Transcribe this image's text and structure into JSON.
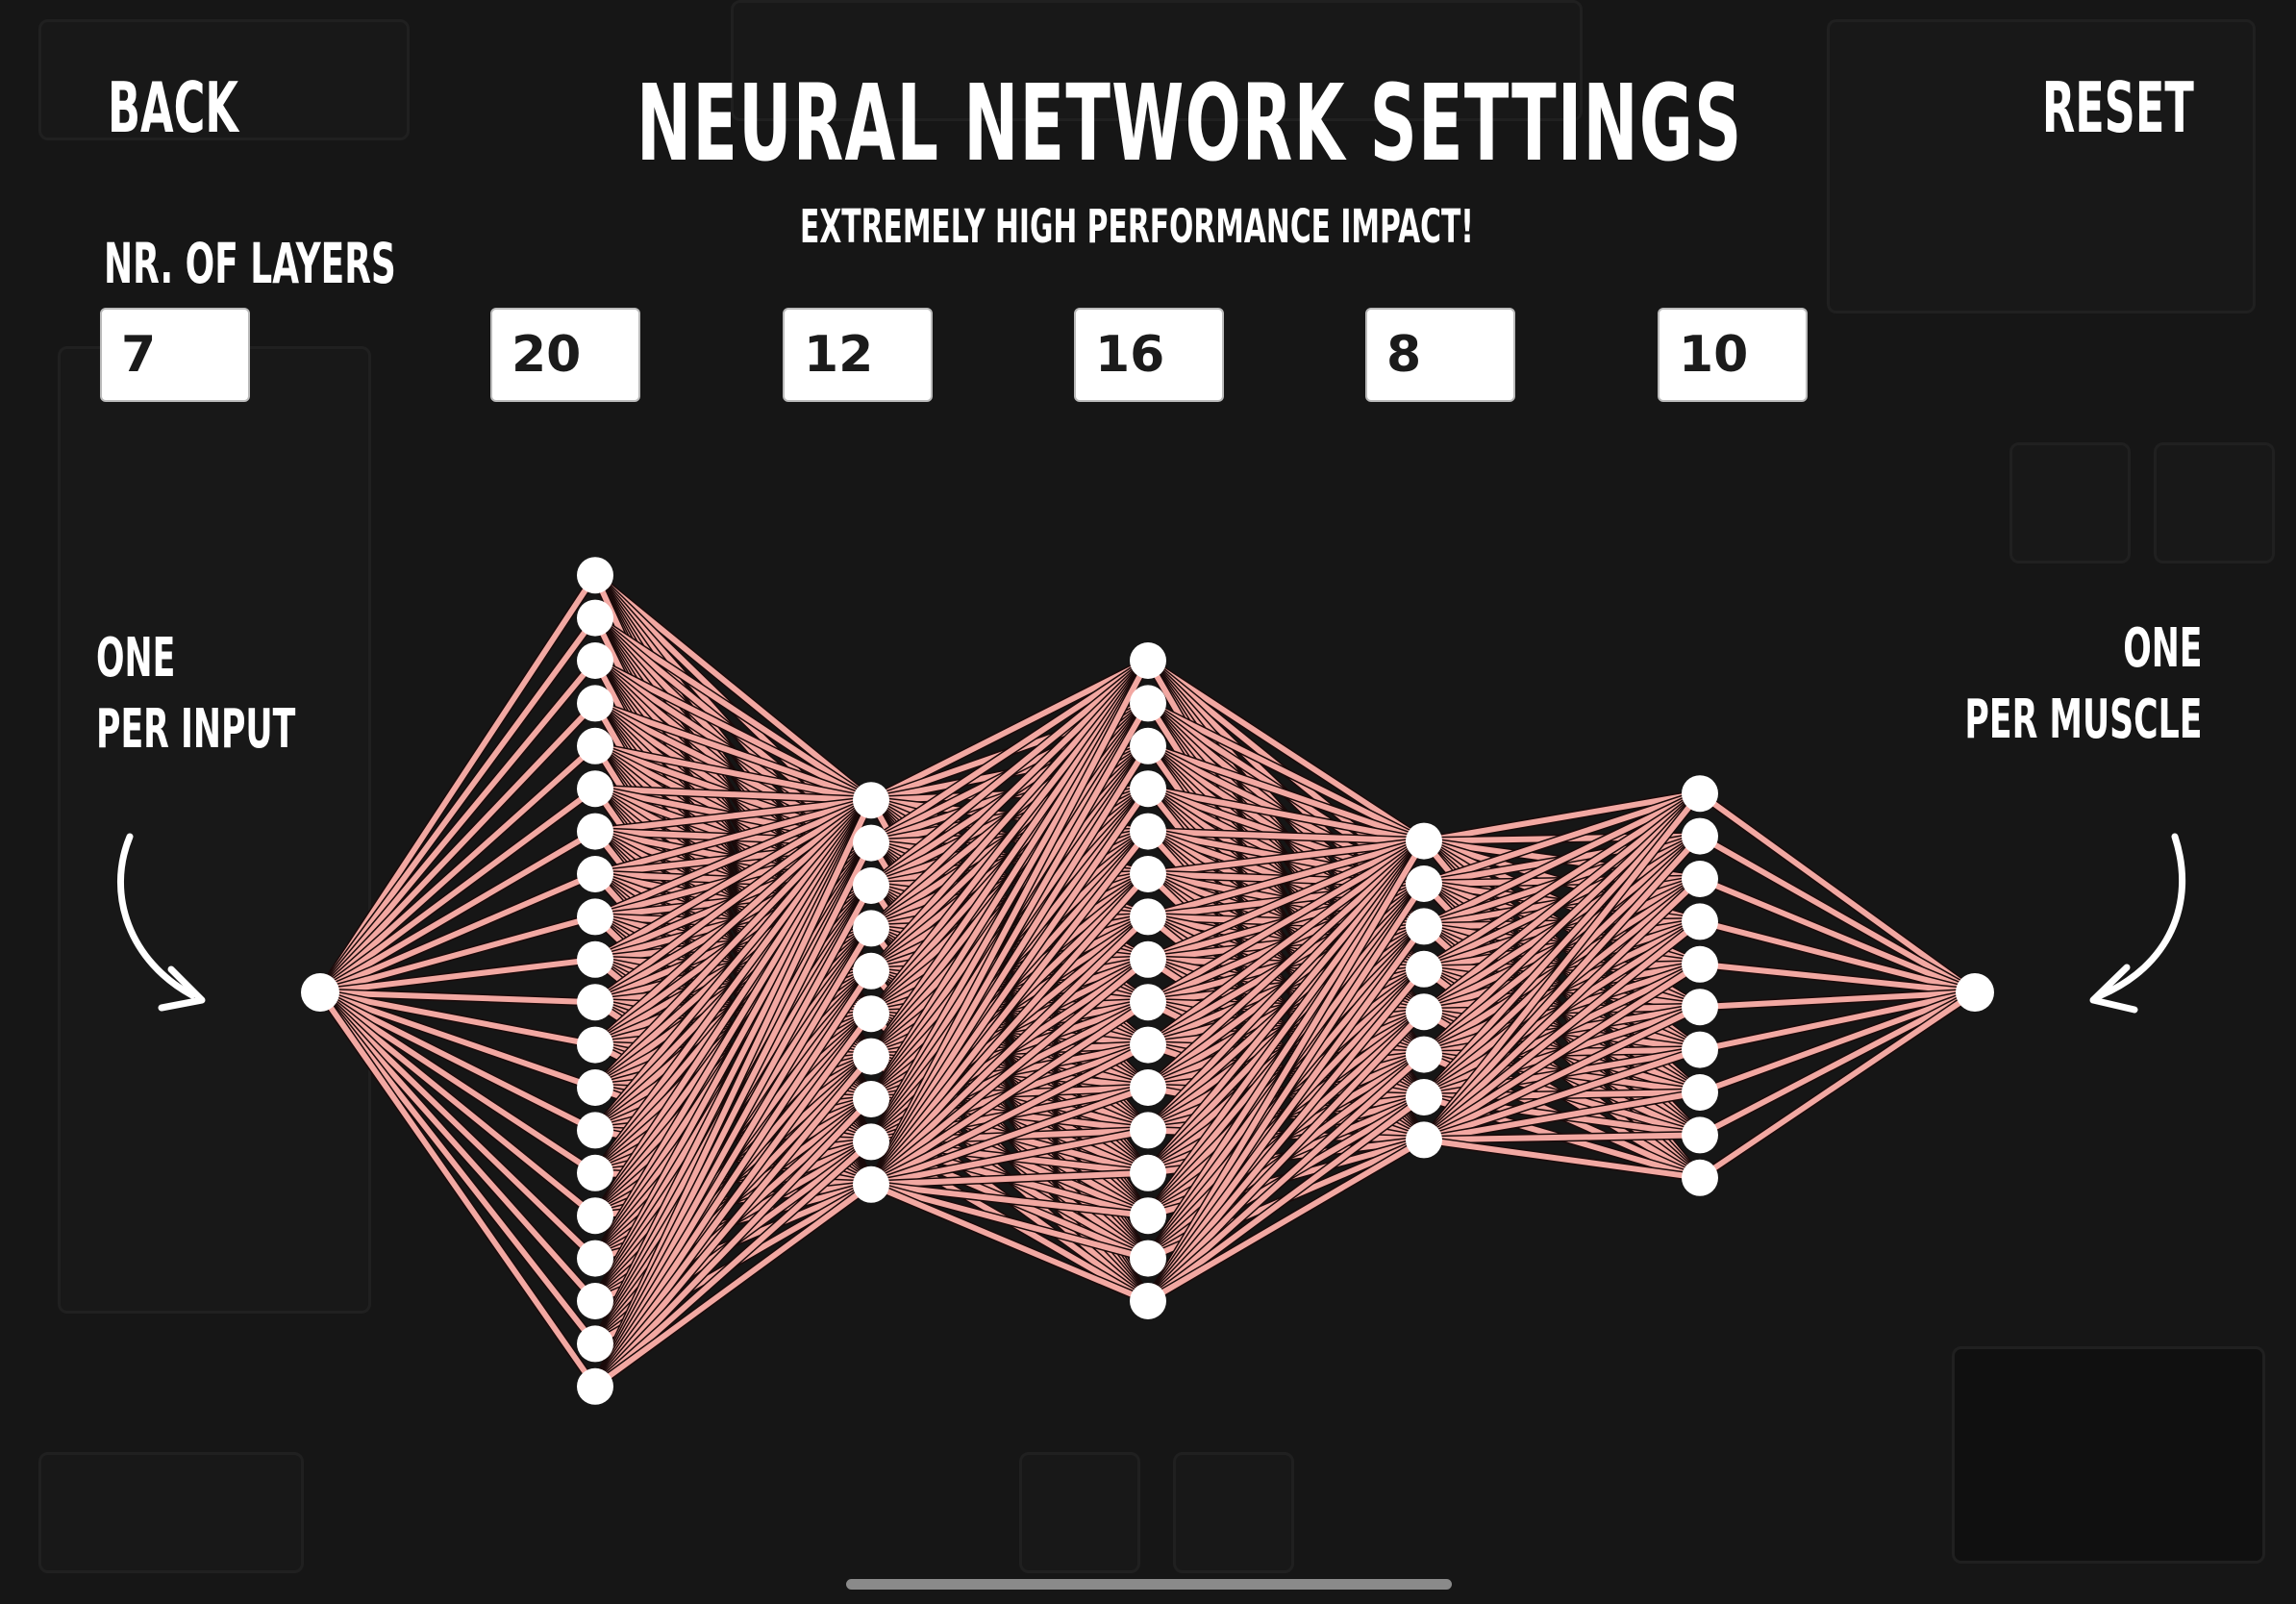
{
  "header": {
    "back_label": "BACK",
    "title": "NEURAL NETWORK SETTINGS",
    "reset_label": "RESET",
    "warning": "EXTREMELY HIGH PERFORMANCE IMPACT!"
  },
  "layers": {
    "label": "NR. OF LAYERS",
    "count": "7",
    "hidden_layer_sizes": [
      "20",
      "12",
      "16",
      "8",
      "10"
    ]
  },
  "network": {
    "input_hint": [
      "ONE",
      "PER INPUT"
    ],
    "output_hint": [
      "ONE",
      "PER MUSCLE"
    ],
    "layer_sizes": [
      1,
      20,
      10,
      16,
      8,
      10,
      1
    ],
    "node_color": "#ffffff",
    "edge_color": "#f2a8a2",
    "edge_outline_color": "#1a0a0a"
  },
  "colors": {
    "background": "#161616",
    "text": "#ffffff",
    "input_bg": "#ffffff",
    "input_text": "#1b1b1b"
  }
}
